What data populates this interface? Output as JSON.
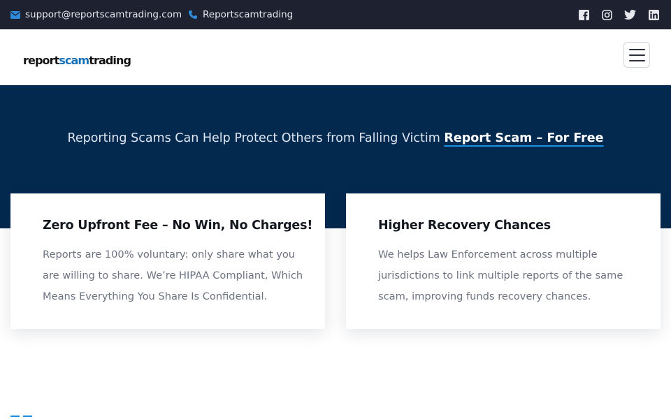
{
  "topbar": {
    "email": "support@reportscamtrading.com",
    "phone": "Reportscamtrading",
    "icons": [
      "envelope-icon",
      "phone-icon",
      "facebook-icon",
      "instagram-icon",
      "twitter-icon",
      "linkedin-icon"
    ]
  },
  "header": {
    "logo_part1": "report",
    "logo_part2": "scam",
    "logo_part3": "trading",
    "menu_icon": "hamburger-icon"
  },
  "hero": {
    "text": "Reporting Scams Can Help Protect Others from Falling Victim",
    "link": "Report Scam – For Free"
  },
  "cards": [
    {
      "title": "Zero Upfront Fee – No Win, No Charges!",
      "body": "Reports are 100% voluntary: only share what you are willing to share. We’re HIPAA Compliant, Which Means Everything You Share Is Confidential."
    },
    {
      "title": "Higher Recovery Chances",
      "body": "We helps Law Enforcement across multiple jurisdictions to link multiple reports of the same scam, improving funds recovery chances."
    }
  ],
  "colors": {
    "topbar_bg": "#1d2130",
    "hero_bg": "#04294f",
    "accent": "#1e8ee0",
    "logo_accent": "#1570b8"
  }
}
